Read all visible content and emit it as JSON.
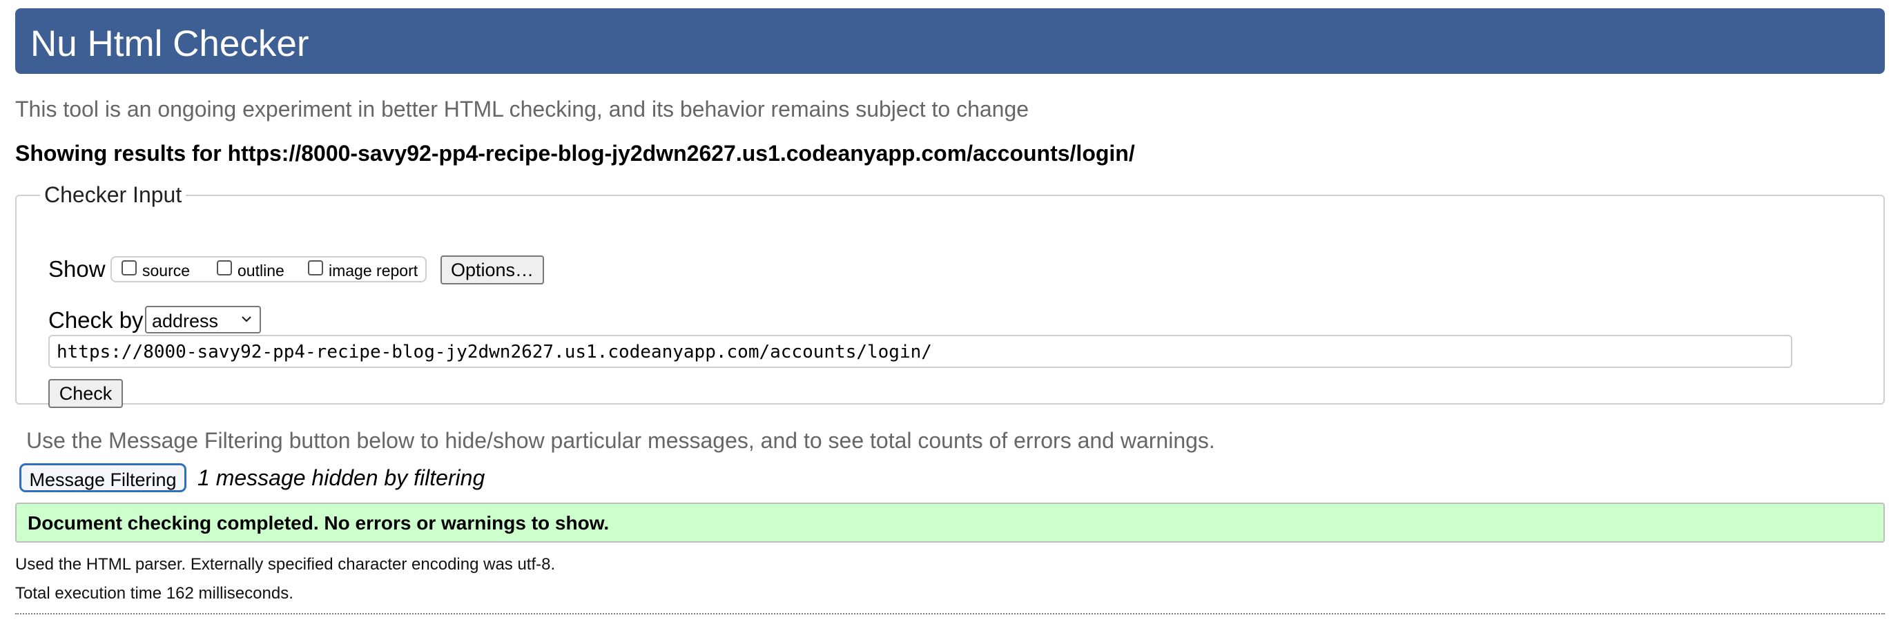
{
  "header": {
    "title": "Nu Html Checker"
  },
  "subtitle": "This tool is an ongoing experiment in better HTML checking, and its behavior remains subject to change",
  "results_heading": "Showing results for https://8000-savy92-pp4-recipe-blog-jy2dwn2627.us1.codeanyapp.com/accounts/login/",
  "checker_input": {
    "legend": "Checker Input",
    "show_label": "Show",
    "show_options": [
      {
        "label": "source",
        "checked": false
      },
      {
        "label": "outline",
        "checked": false
      },
      {
        "label": "image report",
        "checked": false
      }
    ],
    "options_button": "Options…",
    "check_by_label": "Check by",
    "check_by_value": "address",
    "url_value": "https://8000-savy92-pp4-recipe-blog-jy2dwn2627.us1.codeanyapp.com/accounts/login/",
    "check_button": "Check"
  },
  "filtering": {
    "hint": "Use the Message Filtering button below to hide/show particular messages, and to see total counts of errors and warnings.",
    "button": "Message Filtering",
    "hidden_note": "1 message hidden by filtering"
  },
  "result": {
    "message": "Document checking completed. No errors or warnings to show.",
    "color": "#ccffcc"
  },
  "info": {
    "parser": "Used the HTML parser. Externally specified character encoding was utf-8.",
    "time": "Total execution time 162 milliseconds."
  },
  "colors": {
    "header_bg": "#3e5f94",
    "focus_ring": "#2f6fc2"
  }
}
